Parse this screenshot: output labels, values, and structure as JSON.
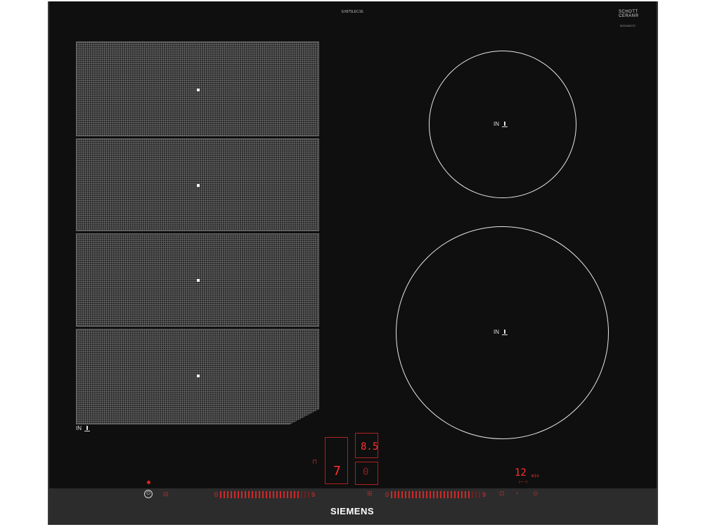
{
  "header": {
    "model_text": "EX875LEC1E",
    "badge_line1": "SCHOTT",
    "badge_line2": "CERAN®",
    "badge_sub": "8001068737"
  },
  "flex_zones": {
    "count": 4,
    "label": "IN"
  },
  "round_zones": [
    {
      "label": "IN"
    },
    {
      "label": "IN"
    }
  ],
  "display": {
    "level_top": "8.5",
    "level_main": "7",
    "level_right": "0",
    "timer_value": "12",
    "timer_unit": "min"
  },
  "controls": {
    "slider_left_start": "0",
    "slider_left_end": "9",
    "slider_right_start": "0",
    "slider_right_end": "9",
    "power_symbol": "⏻"
  },
  "brand": {
    "name": "SIEMENS"
  },
  "colors": {
    "glass": "#0f0f0f",
    "strip": "#2c2c2c",
    "display_red": "#ff3030",
    "zone_grid": "#2a2a2a"
  }
}
